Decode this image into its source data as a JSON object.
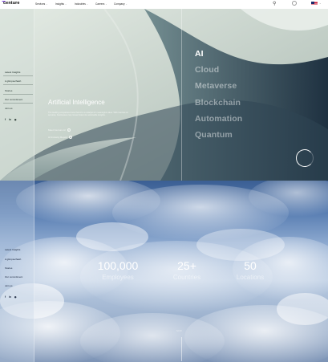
{
  "nav": {
    "logo": "centure",
    "items": [
      {
        "label": "Services"
      },
      {
        "label": "Insights"
      },
      {
        "label": "Industries"
      },
      {
        "label": "Careers"
      },
      {
        "label": "Company"
      }
    ],
    "icons": [
      "search-icon",
      "globe-icon",
      "us-flag-icon"
    ]
  },
  "hero": {
    "sidebar": {
      "items": [
        "Latest Insights",
        "A glimpse/hash",
        "Stories",
        "Our commitment",
        "Join us"
      ],
      "social": [
        "f",
        "in",
        "◉"
      ]
    },
    "title": "Artificial Intelligence",
    "description": "The leading companies know that AI is a catalyst for meaningful value. With Centure AI services, businesses can convert data into actionable insights.",
    "link_primary": "Meet Centure AI",
    "link_secondary": "AI Industry Report",
    "topics": [
      "AI",
      "Cloud",
      "Metaverse",
      "Blockchain",
      "Automation",
      "Quantum"
    ],
    "active_topic": "AI"
  },
  "clouds": {
    "sidebar": {
      "items": [
        "Latest Insights",
        "A glimpse/hash",
        "Stories",
        "Our commitment",
        "Join us"
      ],
      "social": [
        "f",
        "in",
        "◉"
      ]
    },
    "stats": [
      {
        "value": "100,000",
        "label": "Employees"
      },
      {
        "value": "25+",
        "label": "Countries"
      },
      {
        "value": "50",
        "label": "Locations"
      }
    ],
    "scroll_hint": "Scroll"
  },
  "colors": {
    "accent": "#7b3fe4",
    "hero_dark": "#1c3140",
    "sky": "#5a7fb3"
  }
}
